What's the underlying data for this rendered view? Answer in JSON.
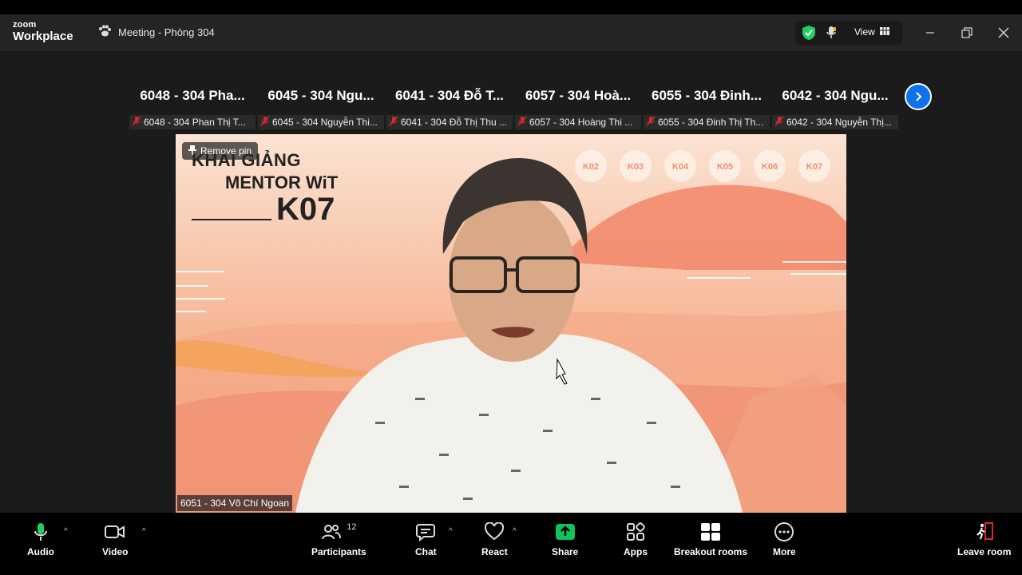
{
  "app": {
    "brand_top": "zoom",
    "brand_bottom": "Workplace"
  },
  "meeting": {
    "title": "Meeting - Phòng 304"
  },
  "topright": {
    "view_label": "View"
  },
  "gallery": {
    "tiles": [
      {
        "name": "6048 - 304 Pha...",
        "label": "6048 - 304 Phan Thị T..."
      },
      {
        "name": "6045 - 304 Ngu...",
        "label": "6045 - 304 Nguyễn Thi..."
      },
      {
        "name": "6041 - 304 Đỗ T...",
        "label": "6041 - 304 Đỗ Thị Thu ..."
      },
      {
        "name": "6057 - 304 Hoà...",
        "label": "6057 - 304 Hoàng Thi ..."
      },
      {
        "name": "6055 - 304 Đinh...",
        "label": "6055 - 304 Đinh Thị Th..."
      },
      {
        "name": "6042 - 304 Ngu...",
        "label": "6042 - 304 Nguyễn Thị..."
      }
    ]
  },
  "video": {
    "remove_pin": "Remove pin",
    "speaker": "6051 - 304 Võ Chí Ngoan",
    "banner_l1": "KHAI GIẢNG",
    "banner_l2": "MENTOR WiT",
    "banner_l3": "K07",
    "badges": [
      "K02",
      "K03",
      "K04",
      "K05",
      "K06",
      "K07"
    ]
  },
  "toolbar": {
    "audio": "Audio",
    "video": "Video",
    "participants": "Participants",
    "participants_count": "12",
    "chat": "Chat",
    "react": "React",
    "share": "Share",
    "apps": "Apps",
    "breakout": "Breakout rooms",
    "more": "More",
    "leave": "Leave room"
  },
  "colors": {
    "accent": "#0e72ed",
    "share": "#10c25b",
    "mic": "#23d160",
    "leave": "#e02828"
  }
}
